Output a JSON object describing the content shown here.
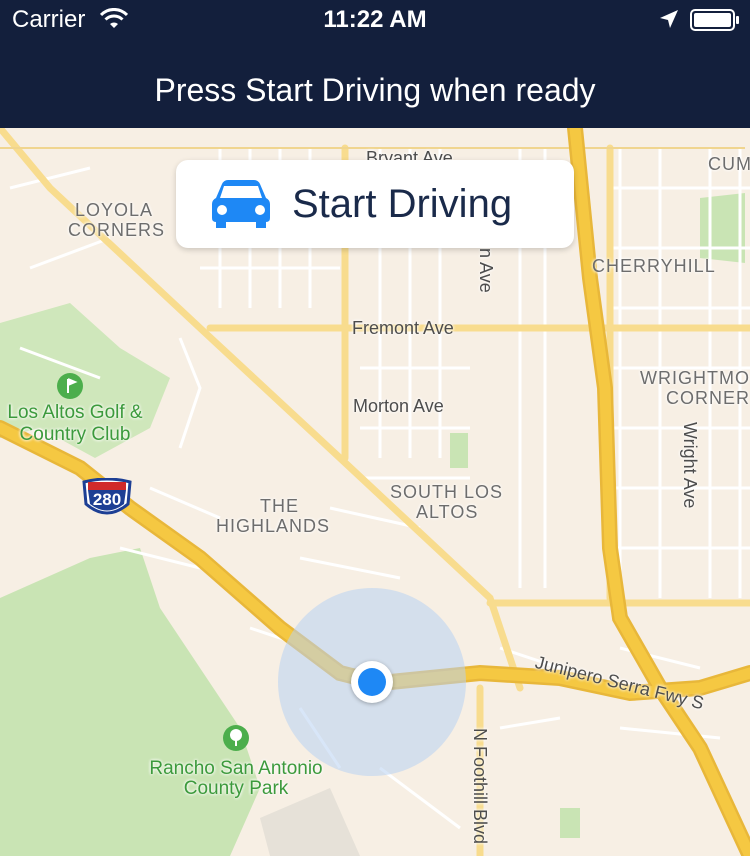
{
  "status_bar": {
    "carrier": "Carrier",
    "time": "11:22 AM",
    "icons": [
      "wifi-icon",
      "location-arrow-icon",
      "battery-icon"
    ]
  },
  "header": {
    "prompt": "Press Start Driving when ready",
    "background": "#131f3c"
  },
  "start_button": {
    "label": "Start Driving",
    "icon": "car-icon",
    "accent": "#1e88f5"
  },
  "map": {
    "labels": {
      "bryant_ave": "Bryant Ave",
      "loyola_1": "LOYOLA",
      "loyola_2": "CORNERS",
      "cum": "CUM",
      "cherryhill": "CHERRYHILL",
      "n_ave": "n Ave",
      "fremont_ave": "Fremont Ave",
      "morton_ave": "Morton Ave",
      "golf_1": "Los Altos Golf &",
      "golf_2": "Country Club",
      "wrightmo_1": "WRIGHTMO",
      "wrightmo_2": "CORNER",
      "wright_ave": "Wright Ave",
      "hwy_280": "280",
      "highlands_1": "THE",
      "highlands_2": "HIGHLANDS",
      "south_los_1": "SOUTH LOS",
      "south_los_2": "ALTOS",
      "junipero": "Junipero Serra Fwy S",
      "rancho_1": "Rancho San Antonio",
      "rancho_2": "County Park",
      "foothill": "N Foothill Blvd"
    },
    "colors": {
      "land": "#f7efe4",
      "park": "#c9e4b4",
      "freeway": "#f5c842",
      "arterial": "#f8dc8e",
      "user_location": "#1e88f5"
    }
  }
}
